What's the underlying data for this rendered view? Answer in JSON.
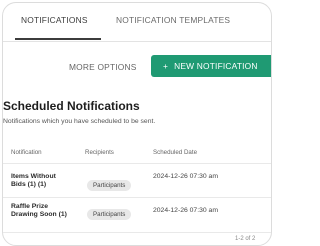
{
  "tabs": [
    {
      "label": "NOTIFICATIONS"
    },
    {
      "label": "NOTIFICATION TEMPLATES"
    }
  ],
  "toolbar": {
    "more_options_label": "MORE OPTIONS",
    "new_notification_label": "NEW NOTIFICATION",
    "new_notification_icon": "plus-icon"
  },
  "section": {
    "title": "Scheduled Notifications",
    "subtitle": "Notifications which you have scheduled to be sent."
  },
  "table": {
    "headers": [
      "Notification",
      "Recipients",
      "Scheduled Date"
    ],
    "rows": [
      {
        "name": "Items Without Bids (1) (1)",
        "recipients": "Participants",
        "date": "2024-12-26 07:30 am"
      },
      {
        "name": "Raffle Prize Drawing Soon (1)",
        "recipients": "Participants",
        "date": "2024-12-26 07:30 am"
      }
    ]
  },
  "pagination": {
    "text": "1-2 of 2"
  },
  "colors": {
    "accent": "#1f9a73",
    "badge_bg": "#e8e8e8",
    "tab_underline": "#3c3c3c"
  }
}
